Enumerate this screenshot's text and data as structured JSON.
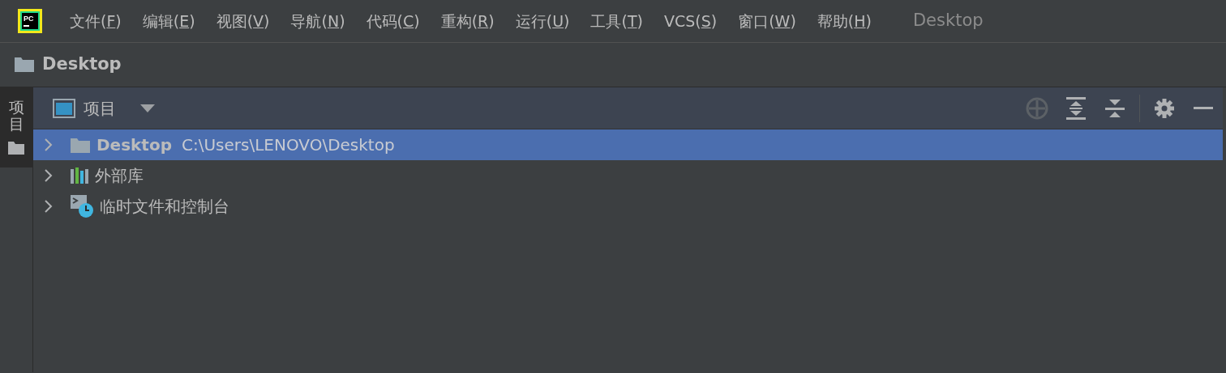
{
  "menu_bar": {
    "items": [
      {
        "label": "文件(F)"
      },
      {
        "label": "编辑(E)"
      },
      {
        "label": "视图(V)"
      },
      {
        "label": "导航(N)"
      },
      {
        "label": "代码(C)"
      },
      {
        "label": "重构(R)"
      },
      {
        "label": "运行(U)"
      },
      {
        "label": "工具(T)"
      },
      {
        "label": "VCS(S)"
      },
      {
        "label": "窗口(W)"
      },
      {
        "label": "帮助(H)"
      }
    ],
    "project_title": "Desktop",
    "logo_text": "PC"
  },
  "breadcrumb": {
    "label": "Desktop"
  },
  "side_strip": {
    "tabs": [
      {
        "label": "项目",
        "selected": true
      }
    ]
  },
  "project_panel": {
    "title": "项目",
    "tree": [
      {
        "kind": "folder",
        "name": "Desktop",
        "path": "C:\\Users\\LENOVO\\Desktop",
        "selected": true,
        "expanded": false
      },
      {
        "kind": "library",
        "name": "外部库",
        "selected": false,
        "expanded": false
      },
      {
        "kind": "scratches",
        "name": "临时文件和控制台",
        "selected": false,
        "expanded": false
      }
    ]
  }
}
